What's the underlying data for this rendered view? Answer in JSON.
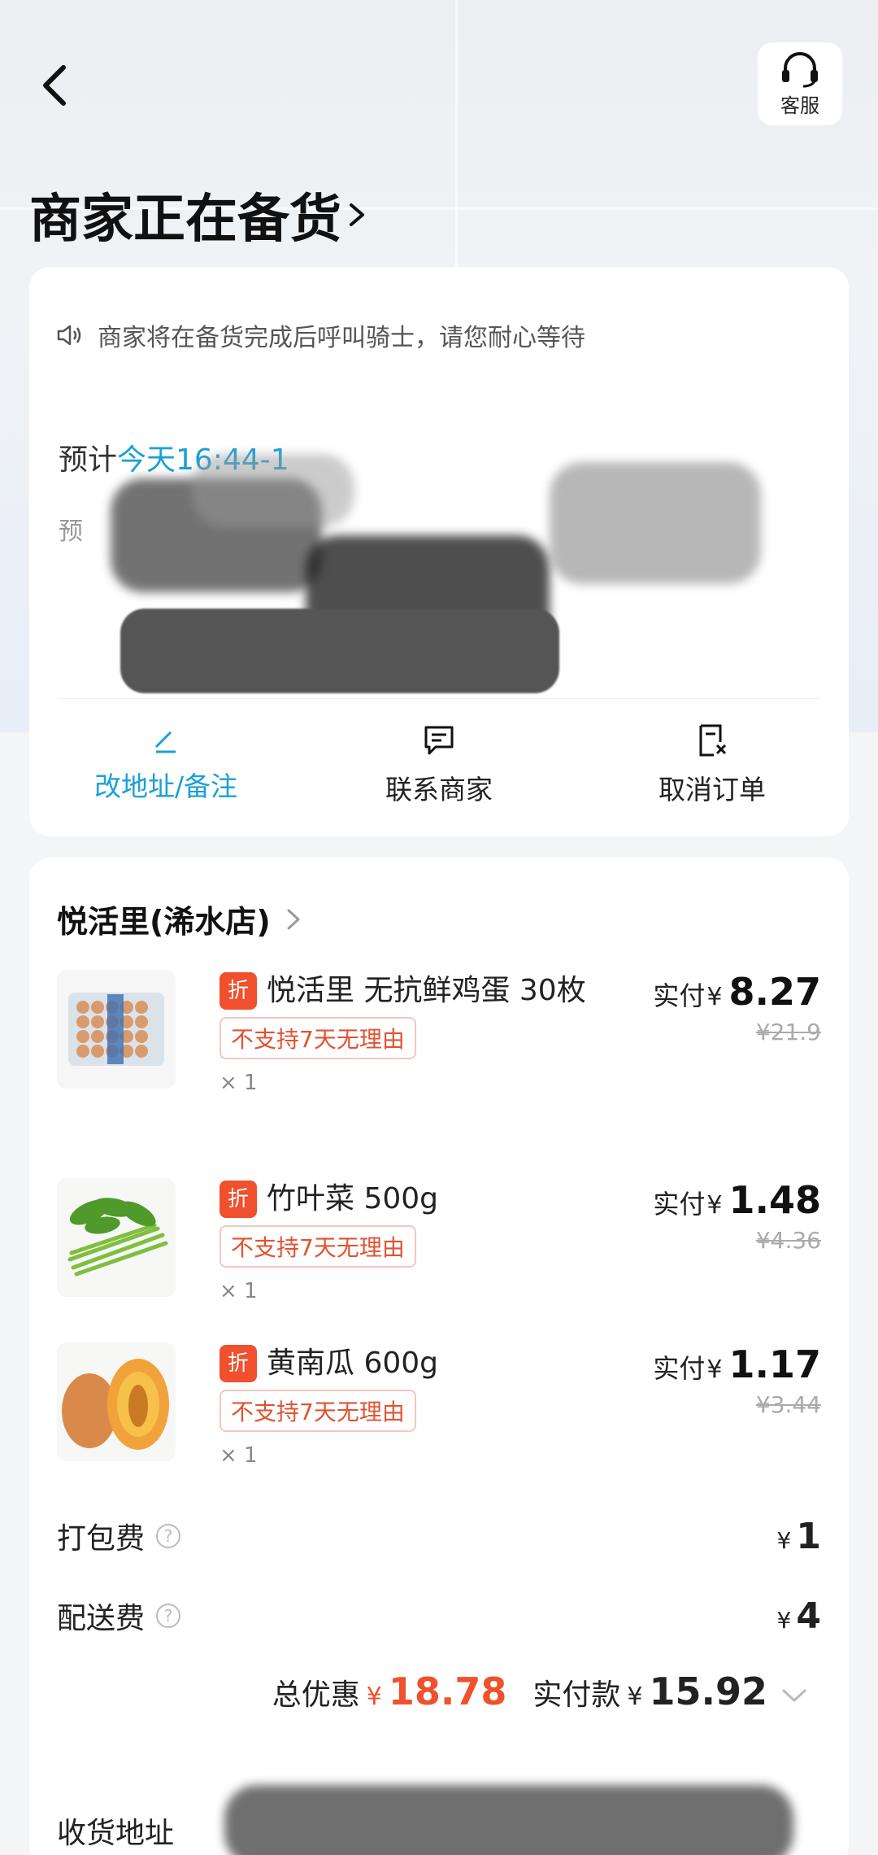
{
  "header": {
    "back_icon": "chevron-left-icon",
    "service_label": "客服",
    "service_icon": "headset-icon",
    "status_title": "商家正在备货"
  },
  "status_card": {
    "notice": "商家将在备货完成后呼叫骑士，请您耐心等待",
    "eta_prefix": "预计",
    "eta_time": "今天16:44-1",
    "eta_sub": "预"
  },
  "actions": [
    {
      "label": "改地址/备注",
      "icon": "edit-pin-icon",
      "active": true
    },
    {
      "label": "联系商家",
      "icon": "chat-icon",
      "active": false
    },
    {
      "label": "取消订单",
      "icon": "cancel-doc-icon",
      "active": false
    }
  ],
  "order": {
    "shop_name": "悦活里(浠水店)",
    "pay_prefix": "实付",
    "yen": "¥",
    "items": [
      {
        "badge": "折",
        "title": "悦活里 无抗鲜鸡蛋 30枚",
        "tag": "不支持7天无理由",
        "qty": "× 1",
        "pay": "8.27",
        "orig": "¥21.9"
      },
      {
        "badge": "折",
        "title": "竹叶菜 500g",
        "tag": "不支持7天无理由",
        "qty": "× 1",
        "pay": "1.48",
        "orig": "¥4.36"
      },
      {
        "badge": "折",
        "title": "黄南瓜 600g",
        "tag": "不支持7天无理由",
        "qty": "× 1",
        "pay": "1.17",
        "orig": "¥3.44"
      }
    ],
    "packing_fee_label": "打包费",
    "packing_fee": "1",
    "delivery_fee_label": "配送费",
    "delivery_fee": "4",
    "discount_label": "总优惠",
    "discount": "18.78",
    "total_label": "实付款",
    "total": "15.92",
    "address_label": "收货地址"
  },
  "colors": {
    "accent": "#1aa0d8",
    "discount_red": "#f0502e"
  }
}
